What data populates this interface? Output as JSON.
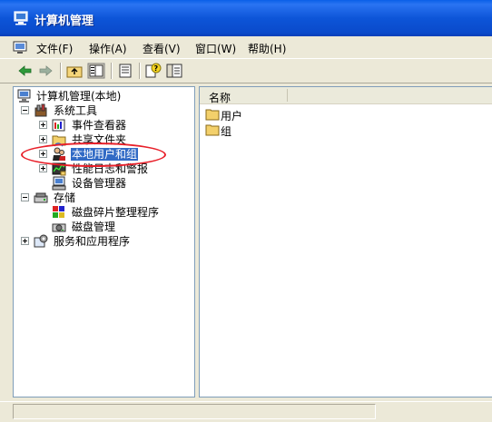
{
  "window": {
    "title": "计算机管理",
    "icon": "computer-management-icon"
  },
  "menu": {
    "items": [
      {
        "label": "文件(F)"
      },
      {
        "label": "操作(A)"
      },
      {
        "label": "查看(V)"
      },
      {
        "label": "窗口(W)"
      },
      {
        "label": "帮助(H)"
      }
    ]
  },
  "toolbar": {
    "buttons": [
      "back-icon",
      "forward-icon",
      "up-folder-icon",
      "show-hide-tree-icon",
      "export-list-icon",
      "help-icon",
      "properties-icon"
    ]
  },
  "tree": {
    "root": "计算机管理(本地)",
    "system_tools": "系统工具",
    "event_viewer": "事件查看器",
    "shared_folders": "共享文件夹",
    "local_users": "本地用户和组",
    "performance": "性能日志和警报",
    "device_manager": "设备管理器",
    "storage": "存储",
    "defrag": "磁盘碎片整理程序",
    "disk_mgmt": "磁盘管理",
    "services": "服务和应用程序"
  },
  "list": {
    "header": "名称",
    "items": [
      {
        "label": "用户"
      },
      {
        "label": "组"
      }
    ]
  },
  "colors": {
    "titlebar": "#0A4ACB",
    "selection": "#316AC5",
    "annotation": "#E8202A"
  }
}
